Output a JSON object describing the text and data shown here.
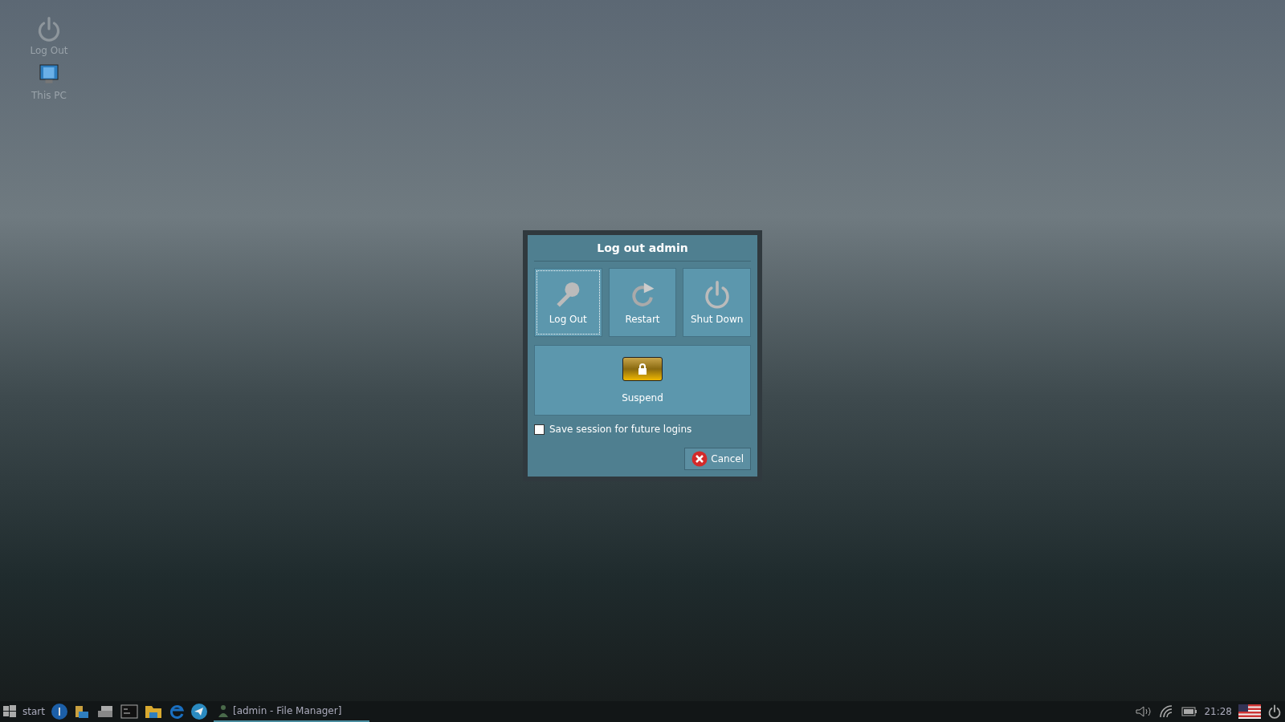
{
  "desktop_icons": [
    {
      "label": "Log Out",
      "kind": "power"
    },
    {
      "label": "This PC",
      "kind": "computer"
    }
  ],
  "dialog": {
    "title": "Log out admin",
    "actions": [
      {
        "label": "Log Out",
        "kind": "key",
        "focused": true
      },
      {
        "label": "Restart",
        "kind": "restart",
        "focused": false
      },
      {
        "label": "Shut Down",
        "kind": "power",
        "focused": false
      }
    ],
    "suspend": {
      "label": "Suspend"
    },
    "save_session": {
      "label": "Save session for future logins",
      "checked": false
    },
    "cancel": {
      "label": "Cancel"
    }
  },
  "taskbar": {
    "start_label": "start",
    "tasks": [
      {
        "label": "[admin - File Manager]",
        "selected": true
      }
    ],
    "clock": "21:28"
  }
}
